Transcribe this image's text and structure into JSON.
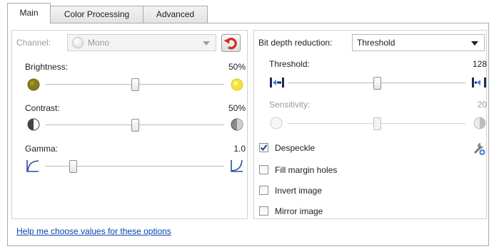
{
  "tabs": [
    {
      "label": "Main",
      "active": true
    },
    {
      "label": "Color Processing",
      "active": false
    },
    {
      "label": "Advanced",
      "active": false
    }
  ],
  "left": {
    "channel": {
      "label": "Channel:",
      "value": "Mono",
      "enabled": false
    },
    "reset_icon": "undo-arrow-icon",
    "brightness": {
      "label": "Brightness:",
      "value_text": "50%",
      "level": 0.5,
      "icons": [
        "dark-bulb-icon",
        "bright-bulb-icon"
      ]
    },
    "contrast": {
      "label": "Contrast:",
      "value_text": "50%",
      "level": 0.5,
      "icons": [
        "low-contrast-icon",
        "high-contrast-icon"
      ]
    },
    "gamma": {
      "label": "Gamma:",
      "value_text": "1.0",
      "level": 0.15,
      "icons": [
        "gamma-low-curve-icon",
        "gamma-high-curve-icon"
      ]
    }
  },
  "right": {
    "bit_depth": {
      "label": "Bit depth reduction:",
      "value": "Threshold"
    },
    "threshold": {
      "label": "Threshold:",
      "value_text": "128",
      "level": 0.5,
      "icons": [
        "threshold-low-icon",
        "threshold-high-icon"
      ]
    },
    "sensitivity": {
      "label": "Sensitivity:",
      "value_text": "20",
      "level": 0.5,
      "enabled": false,
      "icons": [
        "sensitivity-low-icon",
        "sensitivity-high-icon"
      ]
    },
    "checkboxes": [
      {
        "label": "Despeckle",
        "checked": true
      },
      {
        "label": "Fill margin holes",
        "checked": false
      },
      {
        "label": "Invert image",
        "checked": false
      },
      {
        "label": "Mirror image",
        "checked": false
      }
    ],
    "settings_icon": "wrench-settings-icon"
  },
  "help_link": "Help me choose values for these options",
  "colors": {
    "border": "#a9a9a9",
    "link": "#0645ad",
    "disabled_text": "#9a9a9a",
    "reset_arrow": "#d42a25",
    "icon_blue": "#2b4f9a"
  }
}
